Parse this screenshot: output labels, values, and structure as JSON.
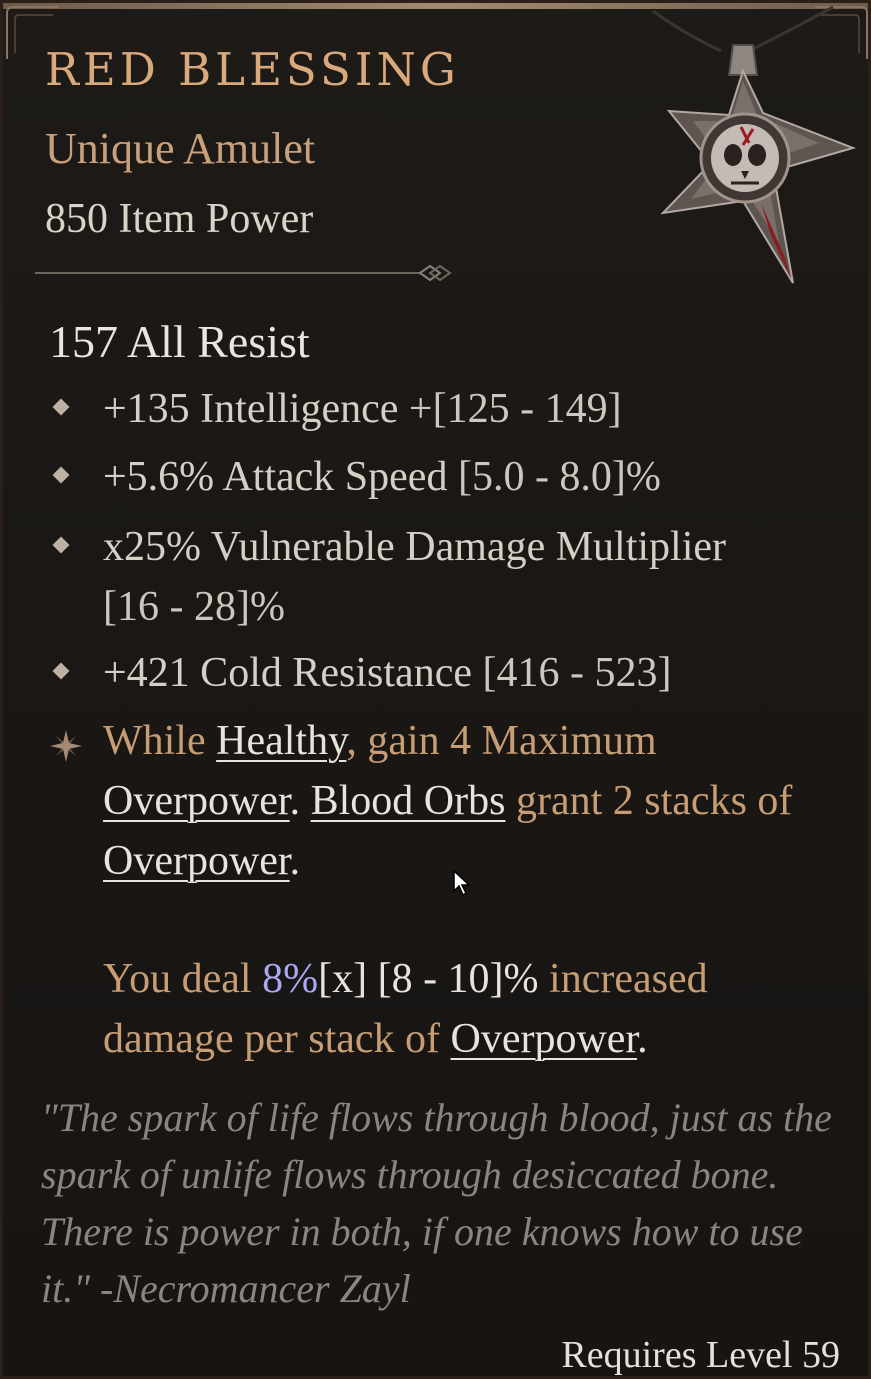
{
  "item": {
    "name": "RED BLESSING",
    "type": "Unique Amulet",
    "power": "850 Item Power",
    "icon": "skull-amulet-icon"
  },
  "implicit": "157 All Resist",
  "affixes": [
    {
      "value": "+135 Intelligence",
      "range": "+[125 - 149]"
    },
    {
      "value": "+5.6% Attack Speed",
      "range": "[5.0 - 8.0]%"
    },
    {
      "value": "x25% Vulnerable Damage Multiplier",
      "range": "[16 - 28]%"
    },
    {
      "value": "+421 Cold Resistance",
      "range": "[416 - 523]"
    }
  ],
  "unique_power": {
    "p1_a": "While ",
    "kw_healthy": "Healthy",
    "p1_b": ", gain 4 Maximum ",
    "kw_overpower_1": "Overpower",
    "p1_c": ". ",
    "kw_blood_orbs": "Blood Orbs",
    "p1_d": " grant 2 stacks of ",
    "kw_overpower_2": "Overpower",
    "p1_e": ".",
    "p2_a": "You deal ",
    "p2_value": "8%",
    "p2_x": "[x]",
    "p2_range": " [8 - 10]% ",
    "p2_b": "increased damage per stack of ",
    "kw_overpower_3": "Overpower",
    "p2_c": "."
  },
  "flavor": "\"The spark of life flows through blood, just as the spark of unlife flows through desiccated bone. There is power in both, if one knows how to use it.\" -Necromancer Zayl",
  "requirement": "Requires Level 59",
  "colors": {
    "name": "#d9a97c",
    "type": "#c9a07c",
    "unique_power": "#c79d74",
    "keyword": "#e8e3dc",
    "value_highlight": "#a9a8f2",
    "flavor": "#8c857e"
  }
}
